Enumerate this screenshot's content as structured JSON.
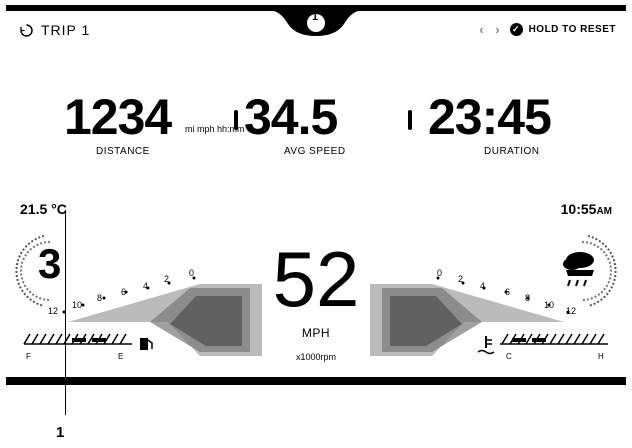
{
  "header": {
    "trip_label": "TRIP 1",
    "page_number": "1",
    "nav_arrows": "‹ ›",
    "reset_label": "HOLD TO RESET"
  },
  "stats": {
    "distance_value": "1234",
    "distance_label": "DISTANCE",
    "units_text": "mi mph hh:mm",
    "avg_speed_value": "34.5",
    "avg_speed_label": "AVG SPEED",
    "duration_value": "23:45",
    "duration_label": "DURATION"
  },
  "status": {
    "temperature": "21.5 °C",
    "time": "10:55",
    "time_suffix": "AM",
    "gear": "3"
  },
  "speedometer": {
    "speed": "52",
    "unit": "MPH",
    "rpm_label": "x1000rpm"
  },
  "left_scale": [
    "12",
    "10",
    "8",
    "6",
    "4",
    "2",
    "0"
  ],
  "right_scale": [
    "0",
    "2",
    "4",
    "6",
    "8",
    "10",
    "12"
  ],
  "fuel": {
    "empty": "E",
    "full": "F"
  },
  "coolant": {
    "cold": "C",
    "hot": "H"
  },
  "callout": "1",
  "icons": [
    "trip-icon",
    "hold-reset-check-icon",
    "fuel-pump-icon",
    "coolant-temperature-icon",
    "weather-rain-cloud-icon"
  ]
}
